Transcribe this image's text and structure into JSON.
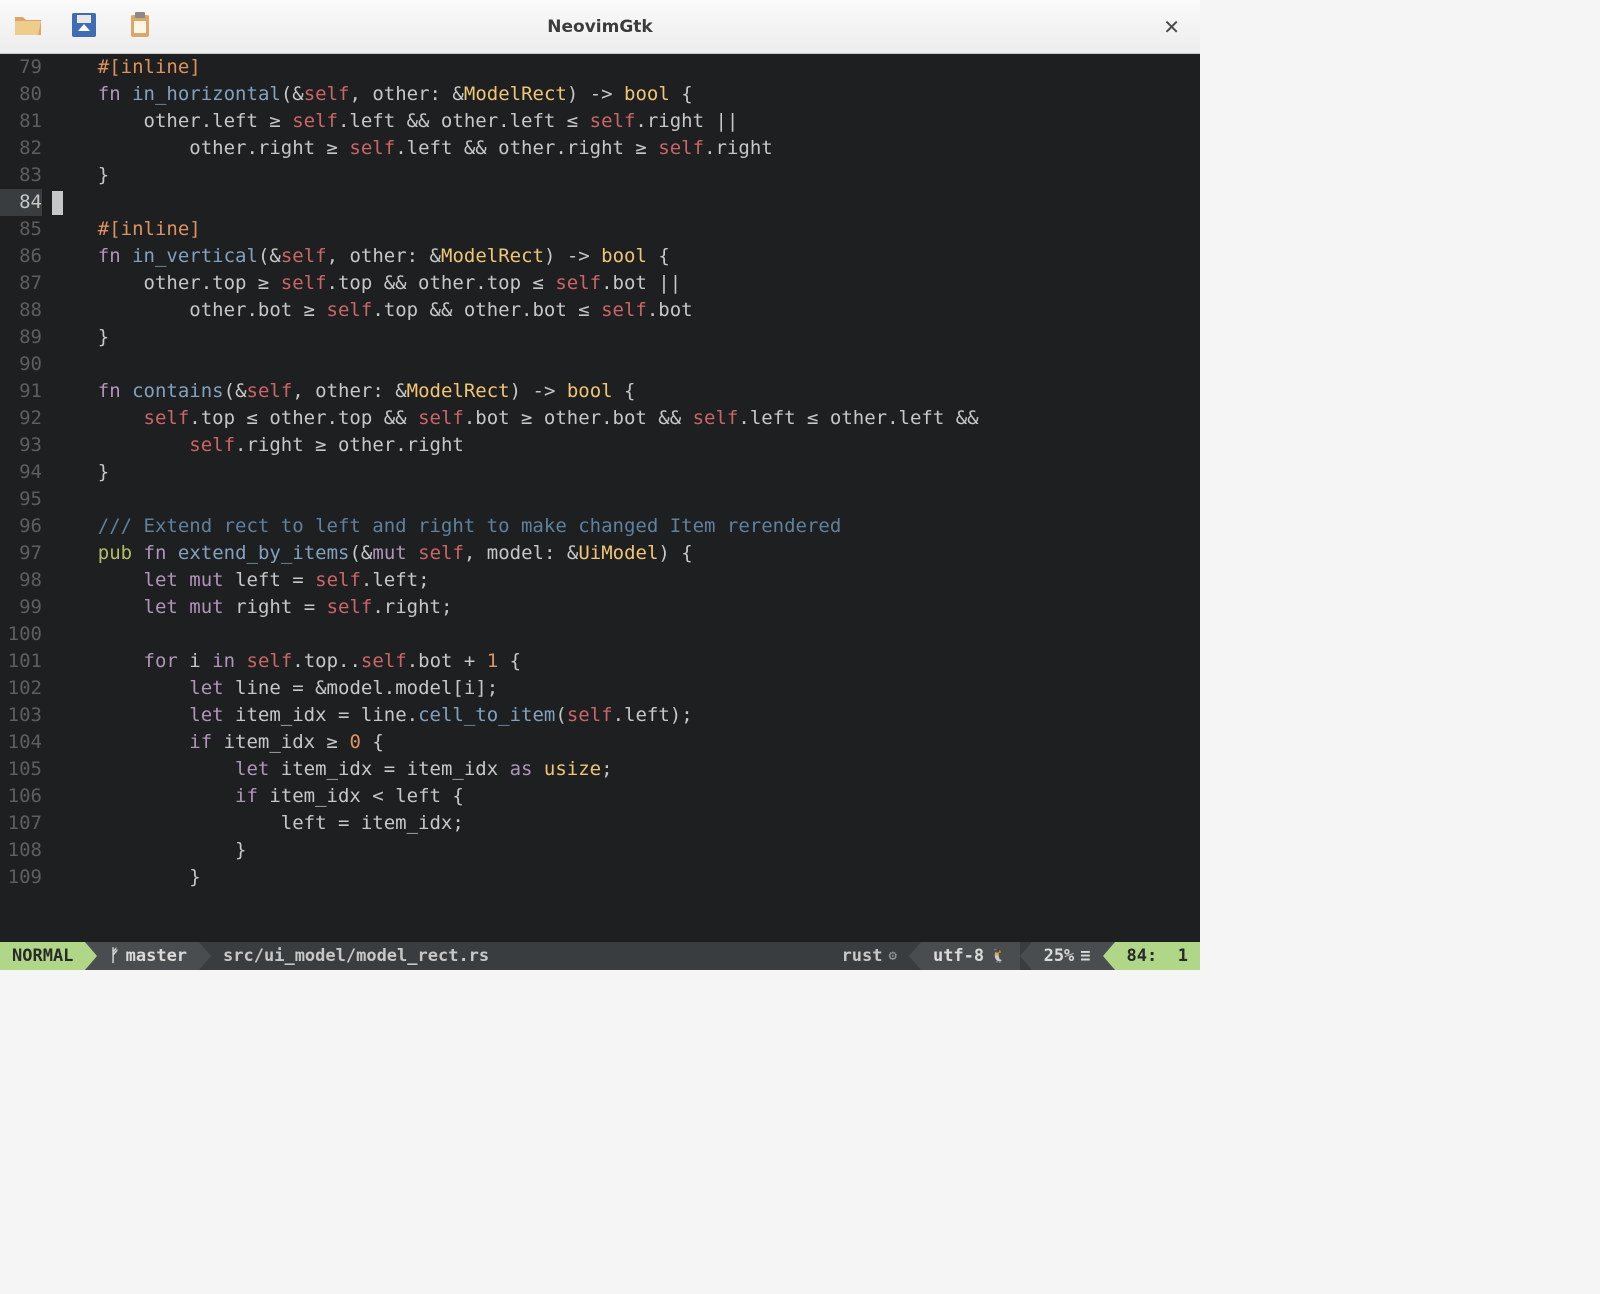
{
  "window": {
    "title": "NeovimGtk"
  },
  "toolbar": {
    "open_icon": "open-folder-icon",
    "save_icon": "save-icon",
    "paste_icon": "paste-icon",
    "close_icon": "close-icon"
  },
  "gutter": {
    "start": 79,
    "end": 109,
    "current": 84
  },
  "code_lines": [
    "    #[inline]",
    "    fn in_horizontal(&self, other: &ModelRect) -> bool {",
    "        other.left ≥ self.left && other.left ≤ self.right ||",
    "            other.right ≥ self.left && other.right ≥ self.right",
    "    }",
    "",
    "    #[inline]",
    "    fn in_vertical(&self, other: &ModelRect) -> bool {",
    "        other.top ≥ self.top && other.top ≤ self.bot ||",
    "            other.bot ≥ self.top && other.bot ≤ self.bot",
    "    }",
    "",
    "    fn contains(&self, other: &ModelRect) -> bool {",
    "        self.top ≤ other.top && self.bot ≥ other.bot && self.left ≤ other.left &&",
    "            self.right ≥ other.right",
    "    }",
    "",
    "    /// Extend rect to left and right to make changed Item rerendered",
    "    pub fn extend_by_items(&mut self, model: &UiModel) {",
    "        let mut left = self.left;",
    "        let mut right = self.right;",
    "",
    "        for i in self.top..self.bot + 1 {",
    "            let line = &model.model[i];",
    "            let item_idx = line.cell_to_item(self.left);",
    "            if item_idx ≥ 0 {",
    "                let item_idx = item_idx as usize;",
    "                if item_idx < left {",
    "                    left = item_idx;",
    "                }",
    "            }"
  ],
  "statusline": {
    "mode": "NORMAL",
    "branch": "master",
    "file": "src/ui_model/model_rect.rs",
    "filetype": "rust",
    "encoding": "utf-8",
    "percent": "25%",
    "line": "84",
    "col": "1"
  }
}
